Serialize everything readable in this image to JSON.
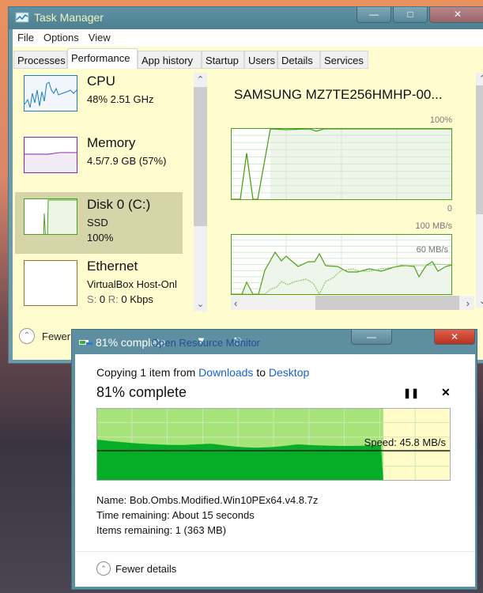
{
  "taskmanager": {
    "title": "Task Manager",
    "menu": [
      "File",
      "Options",
      "View"
    ],
    "tabs": [
      "Processes",
      "Performance",
      "App history",
      "Startup",
      "Users",
      "Details",
      "Services"
    ],
    "active_tab": "Performance",
    "resources": [
      {
        "name": "CPU",
        "line1": "48%  2.51 GHz",
        "color": "#1a7bc1"
      },
      {
        "name": "Memory",
        "line1": "4.5/7.9 GB (57%)",
        "color": "#8b1fb0"
      },
      {
        "name": "Disk 0 (C:)",
        "line1": "SSD",
        "line2": "100%",
        "color": "#4da01c"
      },
      {
        "name": "Ethernet",
        "line1": "VirtualBox Host-Onl",
        "line2_s": "S:",
        "line2_sv": "0",
        "line2_r": "R:",
        "line2_rv": "0 Kbps",
        "color": "#a86a2c"
      }
    ],
    "detail": {
      "title": "SAMSUNG MZ7TE256HMHP-00...",
      "active_max": "100%",
      "active_min": "0",
      "transfer_max": "100 MB/s",
      "transfer_mid": "60 MB/s",
      "disk_active_percent": 100
    },
    "fewer_details": "Fewer details",
    "resource_monitor": "Open Resource Monitor"
  },
  "copy_dialog": {
    "title": "81% complete",
    "copying_prefix": "Copying 1 item from",
    "source": "Downloads",
    "to": "to",
    "destination": "Desktop",
    "heading": "81% complete",
    "progress_percent": 81,
    "speed": "Speed: 45.8 MB/s",
    "name_label": "Name:",
    "name_value": "Bob.Ombs.Modified.Win10PEx64.v4.8.7z",
    "time_label": "Time remaining:",
    "time_value": "About 15 seconds",
    "items_label": "Items remaining:",
    "items_value": "1 (363 MB)",
    "fewer_details": "Fewer details"
  }
}
